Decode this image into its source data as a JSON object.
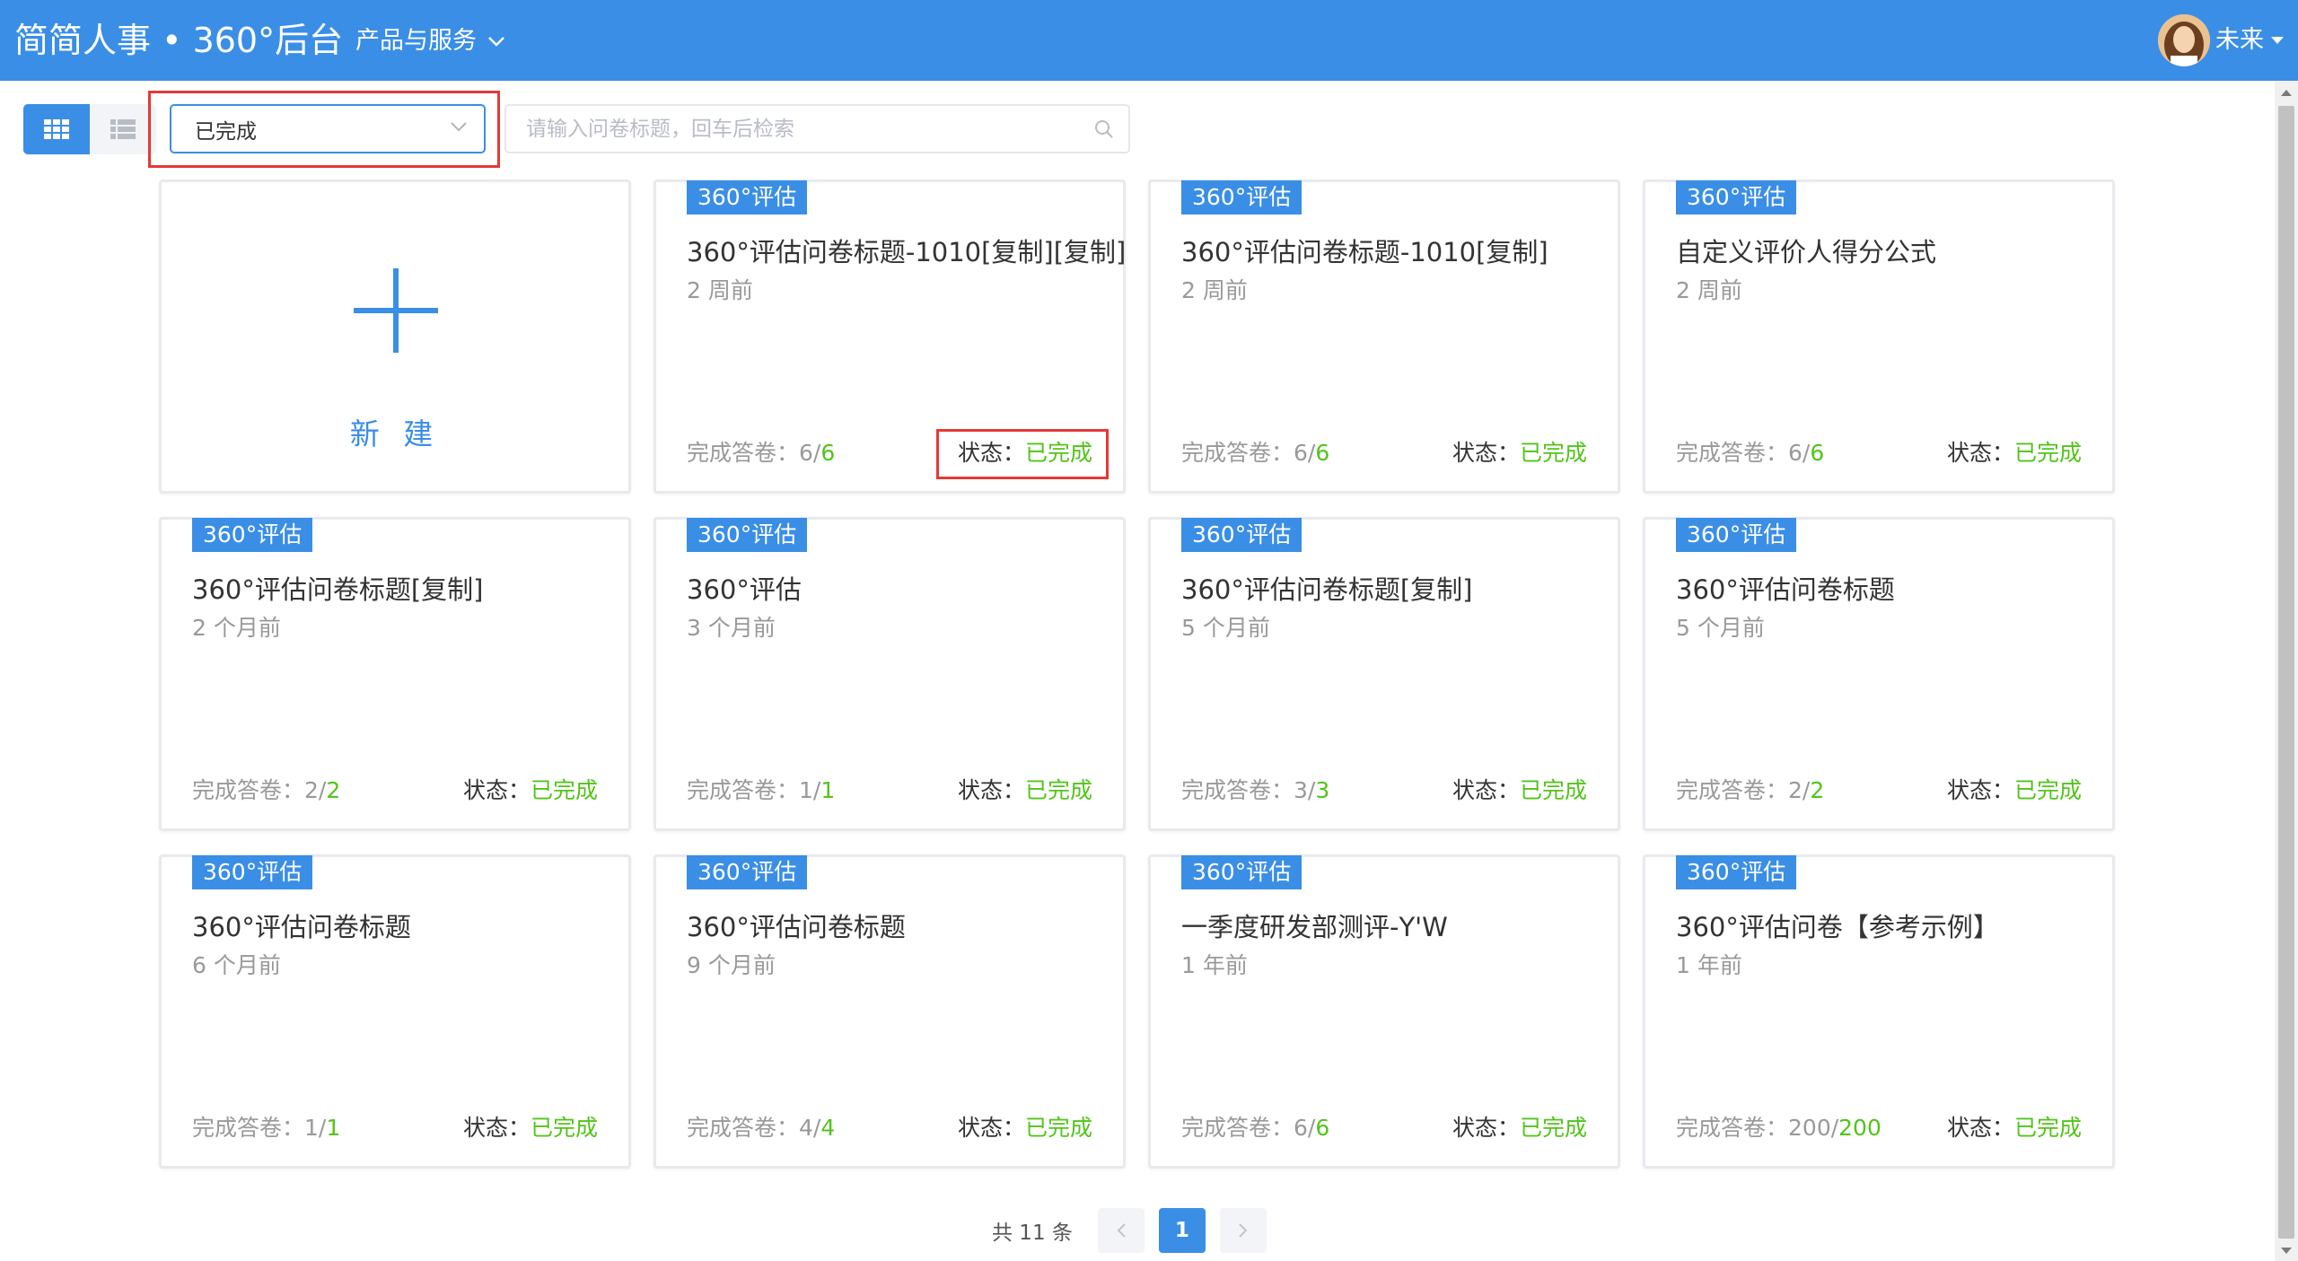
{
  "header": {
    "brand": "简简人事 • 360°后台",
    "nav_menu_label": "产品与服务",
    "user_name": "未来"
  },
  "toolbar": {
    "status_filter_value": "已完成",
    "search_placeholder": "请输入问卷标题，回车后检索",
    "search_value": ""
  },
  "new_card": {
    "label": "新 建"
  },
  "cards": [
    {
      "tag": "360°评估",
      "title": "360°评估问卷标题-1010[复制][复制]",
      "time": "2 周前",
      "count_label": "完成答卷：",
      "count_done": "6/",
      "count_total": "6",
      "status_label": "状态：",
      "status_value": "已完成"
    },
    {
      "tag": "360°评估",
      "title": "360°评估问卷标题-1010[复制]",
      "time": "2 周前",
      "count_label": "完成答卷：",
      "count_done": "6/",
      "count_total": "6",
      "status_label": "状态：",
      "status_value": "已完成"
    },
    {
      "tag": "360°评估",
      "title": "自定义评价人得分公式",
      "time": "2 周前",
      "count_label": "完成答卷：",
      "count_done": "6/",
      "count_total": "6",
      "status_label": "状态：",
      "status_value": "已完成"
    },
    {
      "tag": "360°评估",
      "title": "360°评估问卷标题[复制]",
      "time": "2 个月前",
      "count_label": "完成答卷：",
      "count_done": "2/",
      "count_total": "2",
      "status_label": "状态：",
      "status_value": "已完成"
    },
    {
      "tag": "360°评估",
      "title": "360°评估",
      "time": "3 个月前",
      "count_label": "完成答卷：",
      "count_done": "1/",
      "count_total": "1",
      "status_label": "状态：",
      "status_value": "已完成"
    },
    {
      "tag": "360°评估",
      "title": "360°评估问卷标题[复制]",
      "time": "5 个月前",
      "count_label": "完成答卷：",
      "count_done": "3/",
      "count_total": "3",
      "status_label": "状态：",
      "status_value": "已完成"
    },
    {
      "tag": "360°评估",
      "title": "360°评估问卷标题",
      "time": "5 个月前",
      "count_label": "完成答卷：",
      "count_done": "2/",
      "count_total": "2",
      "status_label": "状态：",
      "status_value": "已完成"
    },
    {
      "tag": "360°评估",
      "title": "360°评估问卷标题",
      "time": "6 个月前",
      "count_label": "完成答卷：",
      "count_done": "1/",
      "count_total": "1",
      "status_label": "状态：",
      "status_value": "已完成"
    },
    {
      "tag": "360°评估",
      "title": "360°评估问卷标题",
      "time": "9 个月前",
      "count_label": "完成答卷：",
      "count_done": "4/",
      "count_total": "4",
      "status_label": "状态：",
      "status_value": "已完成"
    },
    {
      "tag": "360°评估",
      "title": "一季度研发部测评-Y'W",
      "time": "1 年前",
      "count_label": "完成答卷：",
      "count_done": "6/",
      "count_total": "6",
      "status_label": "状态：",
      "status_value": "已完成"
    },
    {
      "tag": "360°评估",
      "title": "360°评估问卷【参考示例】",
      "time": "1 年前",
      "count_label": "完成答卷：",
      "count_done": "200/",
      "count_total": "200",
      "status_label": "状态：",
      "status_value": "已完成"
    }
  ],
  "pagination": {
    "total_text": "共 11 条",
    "current_page": "1"
  },
  "colors": {
    "primary": "#3a8ee6",
    "success": "#52c41a",
    "highlight": "#e53935"
  },
  "icons": {
    "grid_view": "grid-icon",
    "list_view": "list-icon",
    "search": "search-icon",
    "dropdown": "chevron-down-icon",
    "add": "plus-icon"
  }
}
